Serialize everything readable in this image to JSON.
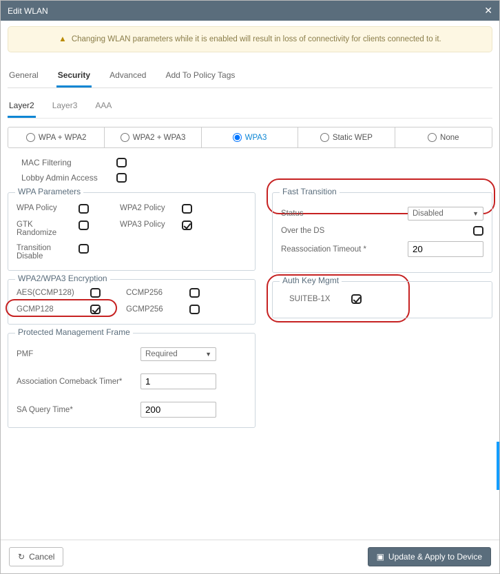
{
  "title": "Edit WLAN",
  "warning": "Changing WLAN parameters while it is enabled will result in loss of connectivity for clients connected to it.",
  "main_tabs": {
    "general": "General",
    "security": "Security",
    "advanced": "Advanced",
    "policy": "Add To Policy Tags"
  },
  "sub_tabs": {
    "layer2": "Layer2",
    "layer3": "Layer3",
    "aaa": "AAA"
  },
  "security_modes": {
    "wpa_wpa2": "WPA + WPA2",
    "wpa2_wpa3": "WPA2 + WPA3",
    "wpa3": "WPA3",
    "static_wep": "Static WEP",
    "none": "None"
  },
  "mac_filtering_label": "MAC Filtering",
  "lobby_admin_label": "Lobby Admin Access",
  "wpa_params": {
    "legend": "WPA Parameters",
    "wpa_policy": "WPA Policy",
    "wpa2_policy": "WPA2 Policy",
    "gtk_randomize": "GTK Randomize",
    "wpa3_policy": "WPA3 Policy",
    "transition_disable": "Transition Disable"
  },
  "encryption": {
    "legend": "WPA2/WPA3 Encryption",
    "aes": "AES(CCMP128)",
    "ccmp256": "CCMP256",
    "gcmp128": "GCMP128",
    "gcmp256": "GCMP256"
  },
  "pmf": {
    "legend": "Protected Management Frame",
    "pmf_label": "PMF",
    "pmf_value": "Required",
    "assoc_label": "Association Comeback Timer*",
    "assoc_value": "1",
    "sa_label": "SA Query Time*",
    "sa_value": "200"
  },
  "fast_transition": {
    "legend": "Fast Transition",
    "status_label": "Status",
    "status_value": "Disabled",
    "over_ds_label": "Over the DS",
    "reassoc_label": "Reassociation Timeout *",
    "reassoc_value": "20"
  },
  "auth_key": {
    "legend": "Auth Key Mgmt",
    "suiteb_label": "SUITEB-1X"
  },
  "footer": {
    "cancel": "Cancel",
    "apply": "Update & Apply to Device"
  }
}
